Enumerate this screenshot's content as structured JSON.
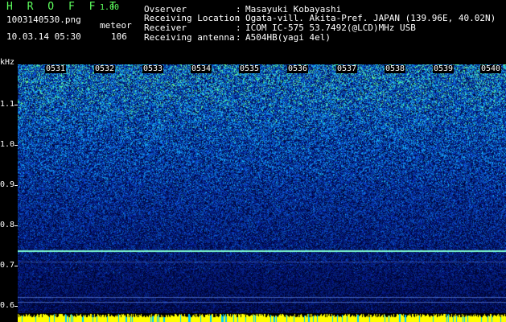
{
  "header": {
    "brand": "H R O F F T",
    "version": "1.00",
    "filename": "1003140530.png",
    "meteor_label": "meteor",
    "datetime": "10.03.14 05:30",
    "meteor_count": "106"
  },
  "info": [
    {
      "key": "Ovserver",
      "value": "Masayuki Kobayashi"
    },
    {
      "key": "Receiving Location",
      "value": "Ogata-vill. Akita-Pref. JAPAN (139.96E, 40.02N)"
    },
    {
      "key": "Receiver",
      "value": "ICOM IC-575 53.7492(@LCD)MHz USB"
    },
    {
      "key": "Receiving antenna",
      "value": "A504HB(yagi 4el)"
    }
  ],
  "separator": ":",
  "y_axis": {
    "unit": "kHz",
    "ticks": [
      "1.1",
      "1.0",
      "0.9",
      "0.8",
      "0.7",
      "0.6"
    ]
  },
  "time_labels": [
    "0531",
    "0532",
    "0533",
    "0534",
    "0535",
    "0536",
    "0537",
    "0538",
    "0539",
    "0540"
  ],
  "colors": {
    "brand": "#5dff5d",
    "text": "#ffffff",
    "carrier_line": "#7fffd0",
    "noise_dark": "#0a1a70",
    "noise_bright": "#40ff90",
    "bottom_strip": "#ffff00"
  }
}
